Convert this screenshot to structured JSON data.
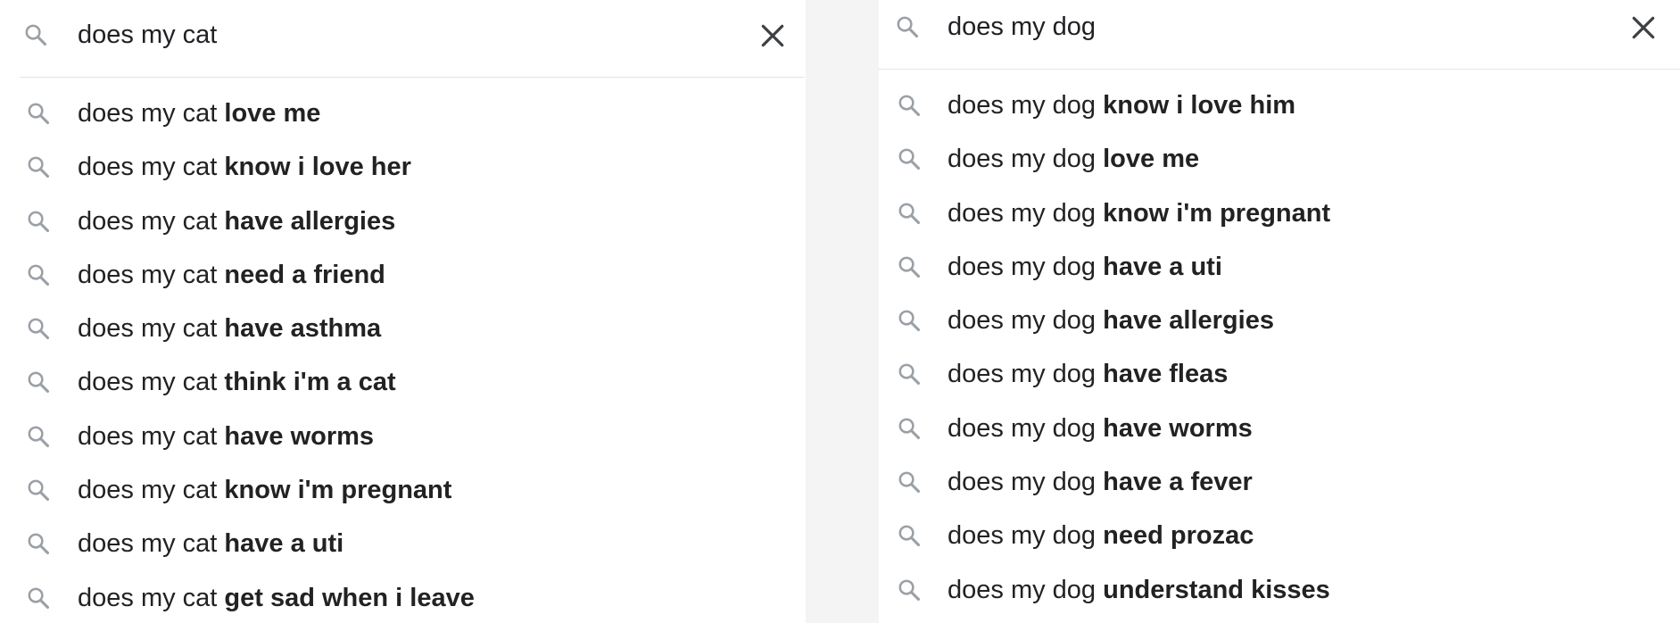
{
  "cat_panel": {
    "query": "does my cat",
    "suggestions": [
      {
        "prefix": "does my cat",
        "completion": "love me"
      },
      {
        "prefix": "does my cat",
        "completion": "know i love her"
      },
      {
        "prefix": "does my cat",
        "completion": "have allergies"
      },
      {
        "prefix": "does my cat",
        "completion": "need a friend"
      },
      {
        "prefix": "does my cat",
        "completion": "have asthma"
      },
      {
        "prefix": "does my cat",
        "completion": "think i'm a cat"
      },
      {
        "prefix": "does my cat",
        "completion": "have worms"
      },
      {
        "prefix": "does my cat",
        "completion": "know i'm pregnant"
      },
      {
        "prefix": "does my cat",
        "completion": "have a uti"
      },
      {
        "prefix": "does my cat",
        "completion": "get sad when i leave"
      }
    ]
  },
  "dog_panel": {
    "query": "does my dog",
    "suggestions": [
      {
        "prefix": "does my dog",
        "completion": "know i love him"
      },
      {
        "prefix": "does my dog",
        "completion": "love me"
      },
      {
        "prefix": "does my dog",
        "completion": "know i'm pregnant"
      },
      {
        "prefix": "does my dog",
        "completion": "have a uti"
      },
      {
        "prefix": "does my dog",
        "completion": "have allergies"
      },
      {
        "prefix": "does my dog",
        "completion": "have fleas"
      },
      {
        "prefix": "does my dog",
        "completion": "have worms"
      },
      {
        "prefix": "does my dog",
        "completion": "have a fever"
      },
      {
        "prefix": "does my dog",
        "completion": "need prozac"
      },
      {
        "prefix": "does my dog",
        "completion": "understand kisses"
      }
    ]
  },
  "icons": {
    "search": "search-icon",
    "clear": "close-icon"
  },
  "colors": {
    "icon_gray": "#9aa0a6",
    "clear_icon": "#3c4043",
    "text": "#202124",
    "divider": "#e4e4e4"
  }
}
